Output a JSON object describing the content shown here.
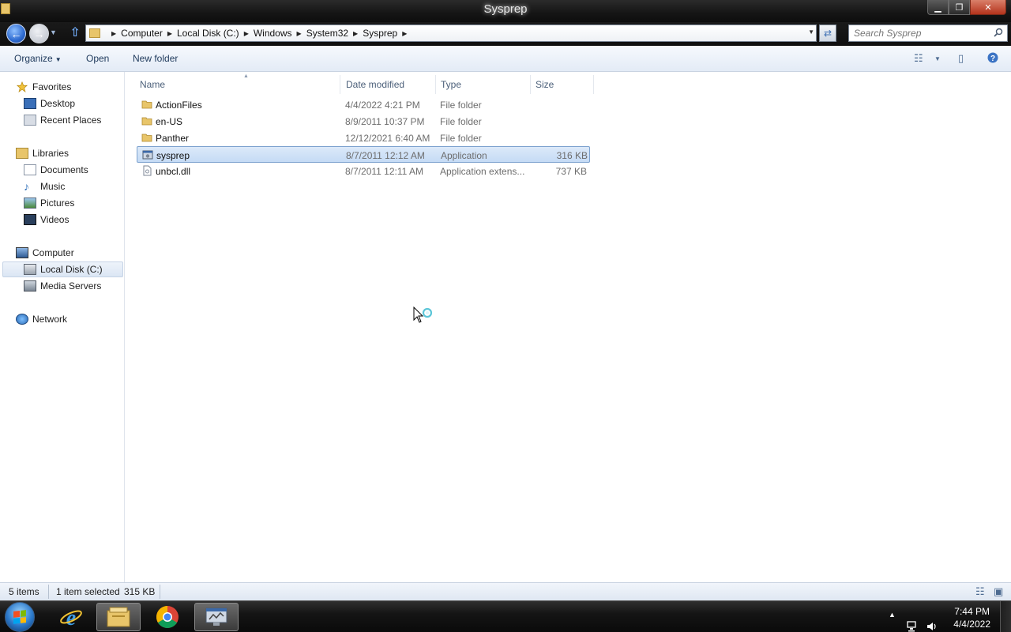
{
  "window": {
    "title": "Sysprep"
  },
  "address": {
    "crumbs": [
      "Computer",
      "Local Disk (C:)",
      "Windows",
      "System32",
      "Sysprep"
    ],
    "search_placeholder": "Search Sysprep"
  },
  "toolbar": {
    "organize_label": "Organize",
    "open_label": "Open",
    "new_folder_label": "New folder"
  },
  "nav": {
    "favorites": "Favorites",
    "desktop": "Desktop",
    "recent_places": "Recent Places",
    "libraries": "Libraries",
    "documents": "Documents",
    "music": "Music",
    "pictures": "Pictures",
    "videos": "Videos",
    "computer": "Computer",
    "local_disk": "Local Disk (C:)",
    "media_servers": "Media Servers",
    "network": "Network"
  },
  "columns": {
    "name": "Name",
    "date": "Date modified",
    "type": "Type",
    "size": "Size"
  },
  "files": [
    {
      "name": "ActionFiles",
      "date": "4/4/2022 4:21 PM",
      "type": "File folder",
      "size": "",
      "icon": "folder-icon"
    },
    {
      "name": "en-US",
      "date": "8/9/2011 10:37 PM",
      "type": "File folder",
      "size": "",
      "icon": "folder-icon"
    },
    {
      "name": "Panther",
      "date": "12/12/2021 6:40 AM",
      "type": "File folder",
      "size": "",
      "icon": "folder-icon"
    },
    {
      "name": "sysprep",
      "date": "8/7/2011 12:12 AM",
      "type": "Application",
      "size": "316 KB",
      "icon": "application-icon",
      "selected": true
    },
    {
      "name": "unbcl.dll",
      "date": "8/7/2011 12:11 AM",
      "type": "Application extens...",
      "size": "737 KB",
      "icon": "dll-file-icon"
    }
  ],
  "status": {
    "item_count": "5 items",
    "selection": "1 item selected",
    "selection_size": "315 KB"
  },
  "taskbar": {
    "time": "7:44 PM",
    "date": "4/4/2022",
    "apps": [
      "internet-explorer-icon",
      "file-explorer-icon",
      "chrome-icon",
      "system-preparation-tool-icon"
    ]
  }
}
